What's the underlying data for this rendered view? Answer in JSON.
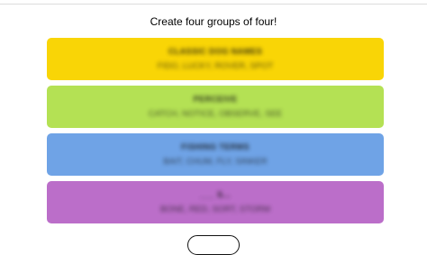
{
  "prompt": "Create four groups of four!",
  "groups": [
    {
      "name": "CLASSIC DOG NAMES",
      "members": "FIDO, LUCKY, ROVER, SPOT",
      "color": "#f9d506"
    },
    {
      "name": "PERCEIVE",
      "members": "CATCH, NOTICE, OBSERVE, SEE",
      "color": "#b4e154"
    },
    {
      "name": "FISHING TERMS",
      "members": "BAIT, CHUM, FLY, SINKER",
      "color": "#6fa3e6"
    },
    {
      "name": "___ S...",
      "members": "BONE, RED, SORT, STORM",
      "color": "#bb6ec9"
    }
  ]
}
